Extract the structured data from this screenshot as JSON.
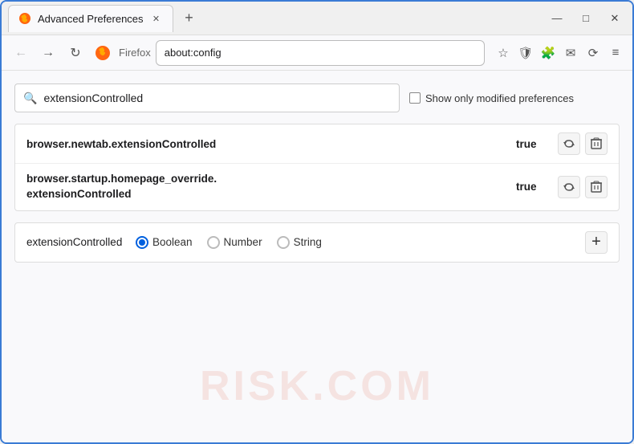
{
  "window": {
    "title": "Advanced Preferences",
    "new_tab_icon": "+",
    "controls": {
      "minimize": "—",
      "maximize": "□",
      "close": "✕"
    }
  },
  "tab": {
    "label": "Advanced Preferences",
    "close": "✕"
  },
  "navbar": {
    "back": "←",
    "forward": "→",
    "reload": "↻",
    "browser_name": "Firefox",
    "url": "about:config",
    "bookmark_icon": "☆",
    "shield_icon": "🛡",
    "extension_icon": "🧩",
    "mail_icon": "✉",
    "sync_icon": "⟳",
    "menu_icon": "≡"
  },
  "search": {
    "placeholder": "extensionControlled",
    "value": "extensionControlled",
    "show_modified_label": "Show only modified preferences"
  },
  "results": [
    {
      "name": "browser.newtab.extensionControlled",
      "value": "true",
      "reset_icon": "⇄",
      "delete_icon": "🗑"
    },
    {
      "name": "browser.startup.homepage_override.\nextensionControlled",
      "name_line1": "browser.startup.homepage_override.",
      "name_line2": "extensionControlled",
      "value": "true",
      "reset_icon": "⇄",
      "delete_icon": "🗑"
    }
  ],
  "add_preference": {
    "name": "extensionControlled",
    "types": [
      {
        "label": "Boolean",
        "selected": true
      },
      {
        "label": "Number",
        "selected": false
      },
      {
        "label": "String",
        "selected": false
      }
    ],
    "add_btn": "+"
  },
  "watermark": "RISK.COM"
}
